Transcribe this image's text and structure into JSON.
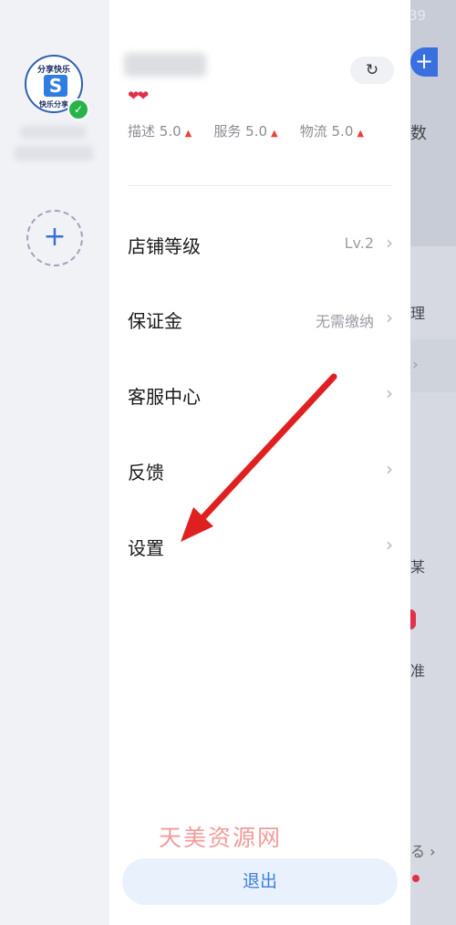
{
  "status_bar": {
    "time": "39"
  },
  "sidebar": {
    "store_avatar": {
      "top_text": "分享快乐",
      "logo_letter": "S",
      "bottom_text": "快乐分享",
      "verified": "✓"
    },
    "add_store": "+"
  },
  "header": {
    "hearts": "❤❤",
    "switch_icon": "↻",
    "ratings": [
      {
        "label": "描述",
        "score": "5.0"
      },
      {
        "label": "服务",
        "score": "5.0"
      },
      {
        "label": "物流",
        "score": "5.0"
      }
    ]
  },
  "menu": {
    "shop_level": {
      "label": "店铺等级",
      "value": "Lv.2"
    },
    "deposit": {
      "label": "保证金",
      "value": "无需缴纳"
    },
    "service_center": {
      "label": "客服中心"
    },
    "feedback": {
      "label": "反馈"
    },
    "settings": {
      "label": "设置"
    },
    "chevron": "›"
  },
  "watermark": "天美资源网",
  "logout_label": "退出",
  "background_peek": {
    "plus": "+",
    "text_1": "数",
    "text_2": "理",
    "text_3": "某",
    "text_4": "准",
    "text_5": "る ›"
  },
  "colors": {
    "accent": "#3f7fd8",
    "arrow": "#e02020",
    "rating_up": "#ef4036",
    "verified": "#28b34a"
  }
}
